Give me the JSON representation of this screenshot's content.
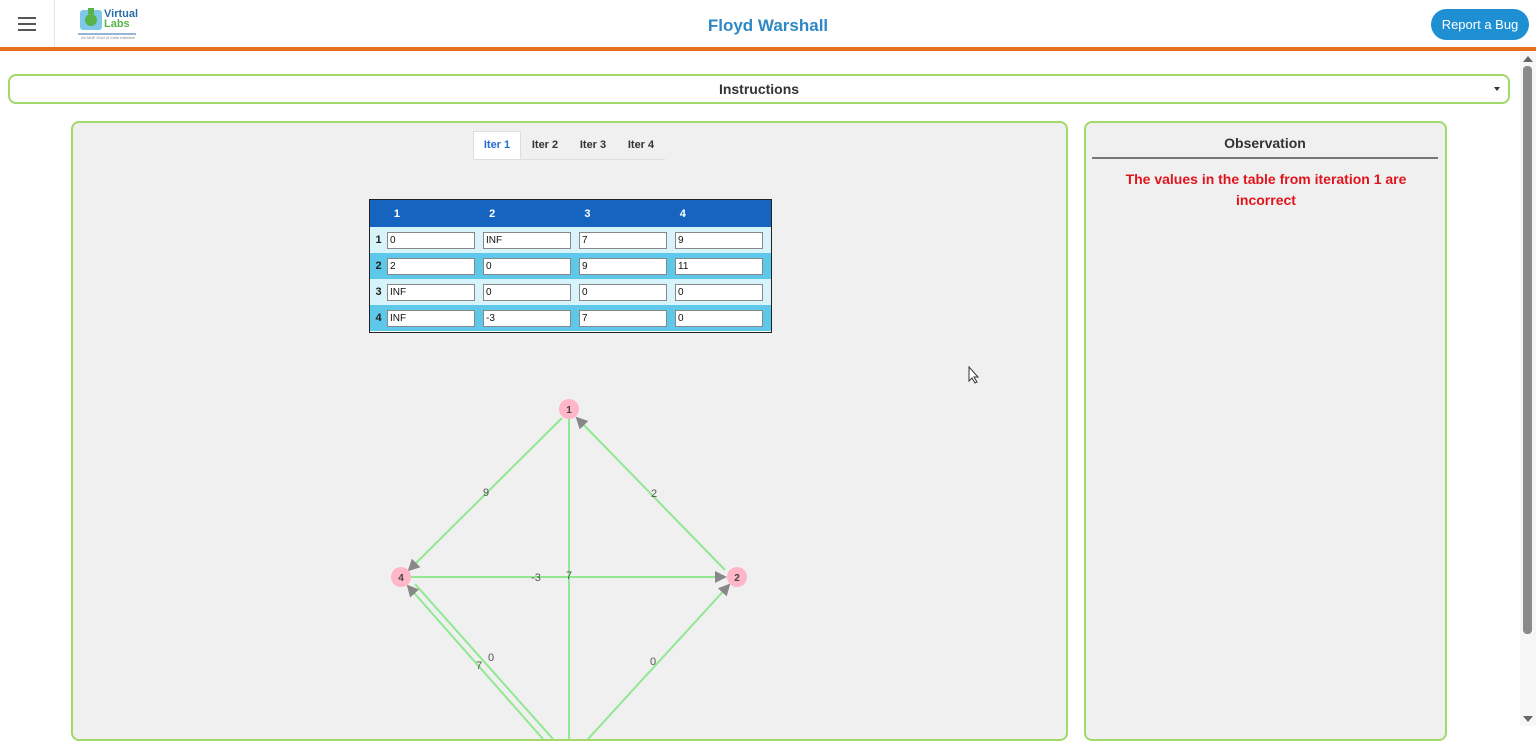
{
  "header": {
    "title": "Floyd Warshall",
    "report_bug_label": "Report a Bug",
    "logo_text_line1": "Virtual",
    "logo_text_line2": "Labs",
    "logo_tagline": "An MoE Govt of India Initiative"
  },
  "instructions": {
    "label": "Instructions"
  },
  "tabs": [
    {
      "label": "Iter 1",
      "active": true
    },
    {
      "label": "Iter 2",
      "active": false
    },
    {
      "label": "Iter 3",
      "active": false
    },
    {
      "label": "Iter 4",
      "active": false
    }
  ],
  "matrix": {
    "columns": [
      "1",
      "2",
      "3",
      "4"
    ],
    "rows": [
      {
        "label": "1",
        "values": [
          "0",
          "INF",
          "7",
          "9"
        ]
      },
      {
        "label": "2",
        "values": [
          "2",
          "0",
          "9",
          "11"
        ]
      },
      {
        "label": "3",
        "values": [
          "INF",
          "0",
          "0",
          "0"
        ]
      },
      {
        "label": "4",
        "values": [
          "INF",
          "-3",
          "7",
          "0"
        ]
      }
    ]
  },
  "graph": {
    "nodes": [
      "1",
      "2",
      "4"
    ],
    "edge_weights": [
      "9",
      "2",
      "-3",
      "7",
      "0",
      "7",
      "0"
    ]
  },
  "observation": {
    "title": "Observation",
    "message": "The values in the table from iteration 1 are incorrect"
  },
  "colors": {
    "accent_orange": "#e8701c",
    "panel_border": "#a3d86b",
    "table_header": "#1565c0",
    "error_text": "#e0141c",
    "edge": "#90e890",
    "node": "#ffb6c8"
  }
}
